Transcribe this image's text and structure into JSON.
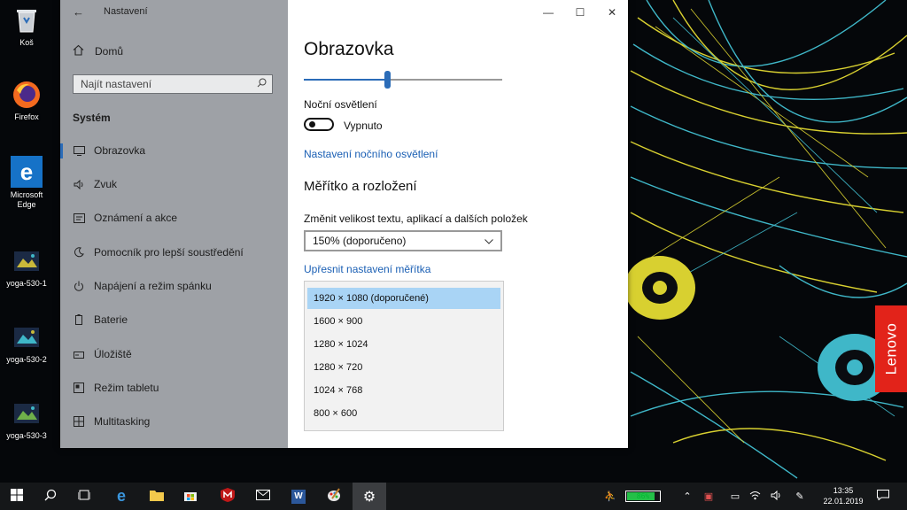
{
  "desktop": {
    "icons": [
      {
        "label": "Koš",
        "icon": "recycle-bin-icon"
      },
      {
        "label": "Firefox",
        "icon": "firefox-icon"
      },
      {
        "label": "Microsoft Edge",
        "icon": "edge-icon"
      },
      {
        "label": "yoga-530-1",
        "icon": "image-file-icon"
      },
      {
        "label": "yoga-530-2",
        "icon": "image-file-icon"
      },
      {
        "label": "yoga-530-3",
        "icon": "image-file-icon"
      }
    ],
    "brand_badge": "Lenovo"
  },
  "window": {
    "title": "Nastavení",
    "controls": {
      "minimize": "—",
      "maximize": "☐",
      "close": "✕"
    }
  },
  "sidebar": {
    "home_label": "Domů",
    "search_placeholder": "Najít nastavení",
    "section_title": "Systém",
    "items": [
      {
        "label": "Obrazovka",
        "icon": "monitor-icon",
        "active": true
      },
      {
        "label": "Zvuk",
        "icon": "speaker-icon"
      },
      {
        "label": "Oznámení a akce",
        "icon": "notification-icon"
      },
      {
        "label": "Pomocník pro lepší soustředění",
        "icon": "moon-icon"
      },
      {
        "label": "Napájení a režim spánku",
        "icon": "power-icon"
      },
      {
        "label": "Baterie",
        "icon": "battery-icon"
      },
      {
        "label": "Úložiště",
        "icon": "storage-icon"
      },
      {
        "label": "Režim tabletu",
        "icon": "tablet-icon"
      },
      {
        "label": "Multitasking",
        "icon": "multitasking-icon"
      }
    ]
  },
  "content": {
    "page_title": "Obrazovka",
    "brightness_percent": 42,
    "night_light_label": "Noční osvětlení",
    "night_light_state": "Vypnuto",
    "night_light_settings_link": "Nastavení nočního osvětlení",
    "scale_section_title": "Měřítko a rozložení",
    "scale_label": "Změnit velikost textu, aplikací a dalších položek",
    "scale_value": "150% (doporučeno)",
    "advanced_scale_link": "Upřesnit nastavení měřítka",
    "resolution_options": [
      "1920 × 1080 (doporučené)",
      "1600 × 900",
      "1280 × 1024",
      "1280 × 720",
      "1024 × 768",
      "800 × 600"
    ],
    "resolution_selected_index": 0
  },
  "taskbar": {
    "apps": [
      "start-icon",
      "search-icon",
      "task-view-icon",
      "edge-icon",
      "file-explorer-icon",
      "store-icon",
      "mcafee-icon",
      "mail-icon",
      "word-icon",
      "paint-icon",
      "settings-icon"
    ],
    "active_app": "settings-icon",
    "battery_text": "86%",
    "battery_level": 0.86,
    "time": "13:35",
    "date": "22.01.2019"
  },
  "colors": {
    "accent": "#2b6cb8",
    "sidebar_bg": "#9ea1a6",
    "selection": "#a9d4f5",
    "lenovo_red": "#e2231a"
  }
}
